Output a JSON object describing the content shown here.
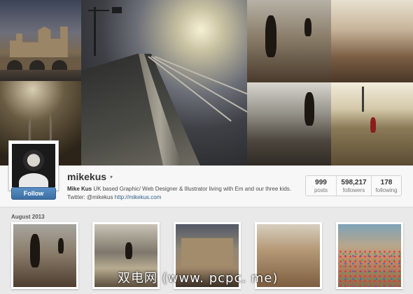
{
  "profile": {
    "username": "mikekus",
    "follow_label": "Follow",
    "bio_name": "Mike Kus",
    "bio_text": "UK based Graphic/ Web Designer & Illustrator living with Em and our three kids. Twitter: @mikekus",
    "bio_link": "http://mikekus.com",
    "stats": [
      {
        "value": "999",
        "label": "posts"
      },
      {
        "value": "598,217",
        "label": "followers"
      },
      {
        "value": "178",
        "label": "following"
      }
    ]
  },
  "feed": {
    "month_label": "August 2013"
  },
  "watermark": "双电网 (www. pcpc. me)"
}
